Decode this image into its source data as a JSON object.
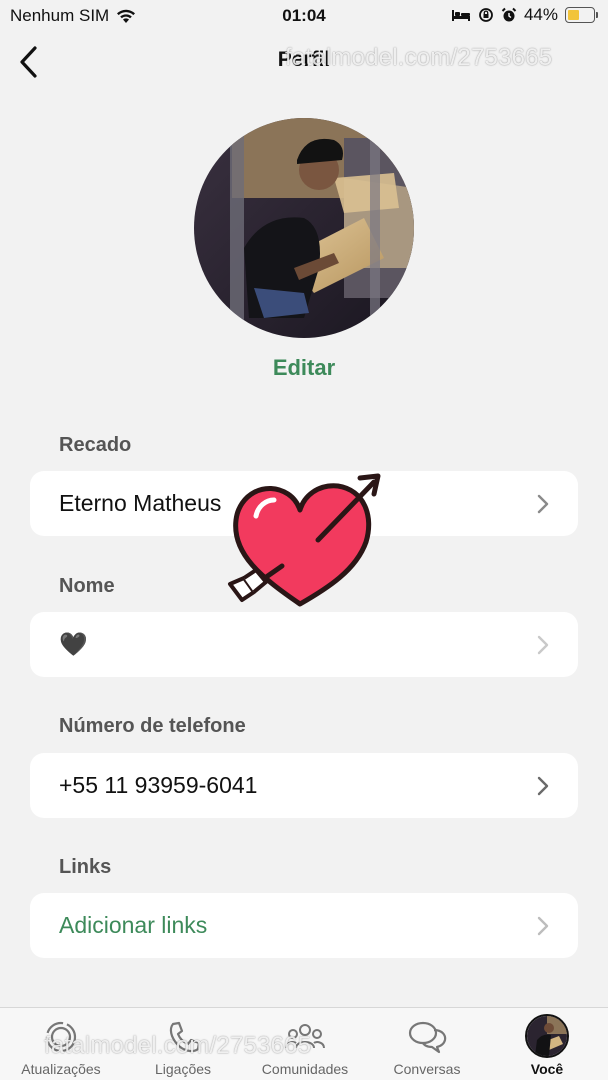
{
  "status_bar": {
    "carrier": "Nenhum SIM",
    "time": "01:04",
    "battery_percent": "44%",
    "battery_level": 0.44,
    "battery_color": "#f2c43a"
  },
  "header": {
    "title": "Perfil",
    "back_icon": "chevron-left-icon"
  },
  "watermark": {
    "top": "fatalmodel.com/2753665",
    "bottom": "fatalmodel.com/2753665"
  },
  "profile": {
    "edit_label": "Editar"
  },
  "fields": [
    {
      "label": "Recado",
      "value": "Eterno Matheus",
      "style": "normal"
    },
    {
      "label": "Nome",
      "value": "🖤",
      "style": "normal"
    },
    {
      "label": "Número de telefone",
      "value": "+55 11 93959-6041",
      "style": "normal"
    },
    {
      "label": "Links",
      "value": "Adicionar links",
      "style": "accent"
    }
  ],
  "colors": {
    "accent": "#3d8a5a",
    "heart_sticker": "#f23a5e"
  },
  "tab_bar": {
    "tabs": [
      {
        "label": "Atualizações",
        "icon": "updates-icon",
        "active": false
      },
      {
        "label": "Ligações",
        "icon": "phone-icon",
        "active": false
      },
      {
        "label": "Comunidades",
        "icon": "communities-icon",
        "active": false
      },
      {
        "label": "Conversas",
        "icon": "chats-icon",
        "active": false
      },
      {
        "label": "Você",
        "icon": "avatar",
        "active": true
      }
    ]
  }
}
